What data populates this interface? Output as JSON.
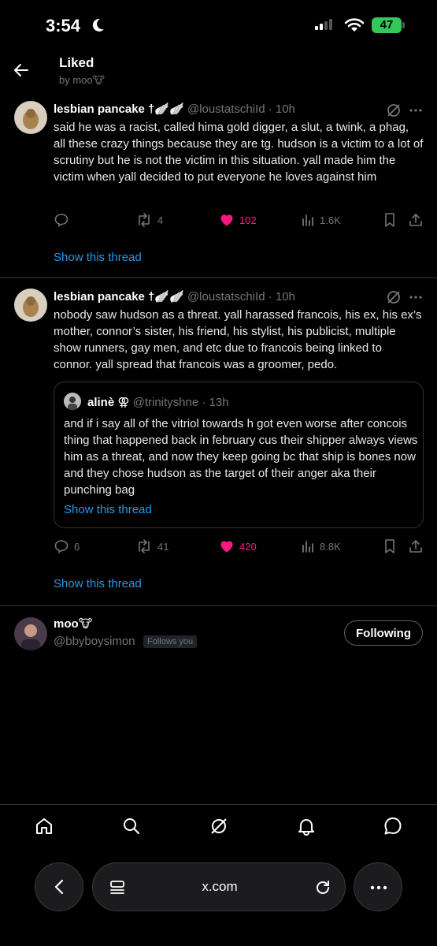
{
  "status": {
    "time": "3:54",
    "battery": "47"
  },
  "header": {
    "title": "Liked",
    "subtitle": "by moo🐮"
  },
  "tweets": [
    {
      "author": "lesbian pancake †🪽🪽",
      "handle": "@loustatschiId · 10h",
      "text": "said he was a racist, called hima gold digger, a slut, a twink, a phag, all these crazy things because they are tg. hudson is a victim to a lot of scrutiny but he is not the victim in this situation. yall made him the victim when yall decided to put everyone he loves against him",
      "replies": "",
      "reposts": "4",
      "likes": "102",
      "views": "1.6K",
      "show_thread": "Show this thread"
    },
    {
      "author": "lesbian pancake †🪽🪽",
      "handle": "@loustatschiId · 10h",
      "text": "nobody saw hudson as a threat. yall harassed francois, his ex, his ex’s mother, connor’s sister, his friend, his stylist, his publicist, multiple show runners, gay men, and etc due to francois being linked to connor. yall spread that francois was a groomer, pedo.",
      "quote": {
        "author": "alinè ⚢",
        "handle": "@trinityshne · 13h",
        "text": "and if i say all of the vitriol towards h got even worse after concois thing that happened back in february cus their shipper always views him as a threat, and now they keep going bc that ship is bones now and they chose hudson as the target of their anger aka their punching bag",
        "show_thread": "Show this thread"
      },
      "replies": "6",
      "reposts": "41",
      "likes": "420",
      "views": "8.8K",
      "show_thread": "Show this thread"
    }
  ],
  "user": {
    "name": "moo🐮",
    "handle": "@bbyboysimon",
    "badge": "Follows you",
    "button": "Following"
  },
  "browser": {
    "url": "x.com"
  },
  "colors": {
    "accent": "#1d9bf0",
    "like": "#f91880",
    "muted": "#71767b",
    "battery": "#34c759"
  }
}
